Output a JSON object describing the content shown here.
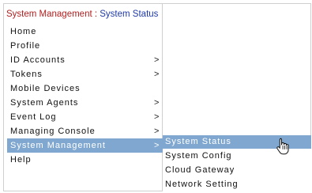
{
  "breadcrumb": {
    "section": "System Management",
    "separator": " : ",
    "page": "System Status"
  },
  "menu": {
    "items": [
      {
        "label": "Home",
        "has_submenu": false
      },
      {
        "label": "Profile",
        "has_submenu": false
      },
      {
        "label": "ID Accounts",
        "has_submenu": true
      },
      {
        "label": "Tokens",
        "has_submenu": true
      },
      {
        "label": "Mobile Devices",
        "has_submenu": false
      },
      {
        "label": "System Agents",
        "has_submenu": true
      },
      {
        "label": "Event Log",
        "has_submenu": true
      },
      {
        "label": "Managing Console",
        "has_submenu": true
      },
      {
        "label": "System Management",
        "has_submenu": true,
        "active": true
      },
      {
        "label": "Help",
        "has_submenu": false
      }
    ],
    "chevron": ">"
  },
  "submenu": {
    "items": [
      {
        "label": "System Status",
        "highlighted": true
      },
      {
        "label": "System Config"
      },
      {
        "label": "Cloud Gateway"
      },
      {
        "label": "Network Setting"
      }
    ]
  },
  "colors": {
    "highlight": "#7fa7cf",
    "breadcrumb_section": "#b32020",
    "breadcrumb_page": "#1f3aa8"
  },
  "icons": {
    "cursor": "hand-pointer-icon"
  }
}
